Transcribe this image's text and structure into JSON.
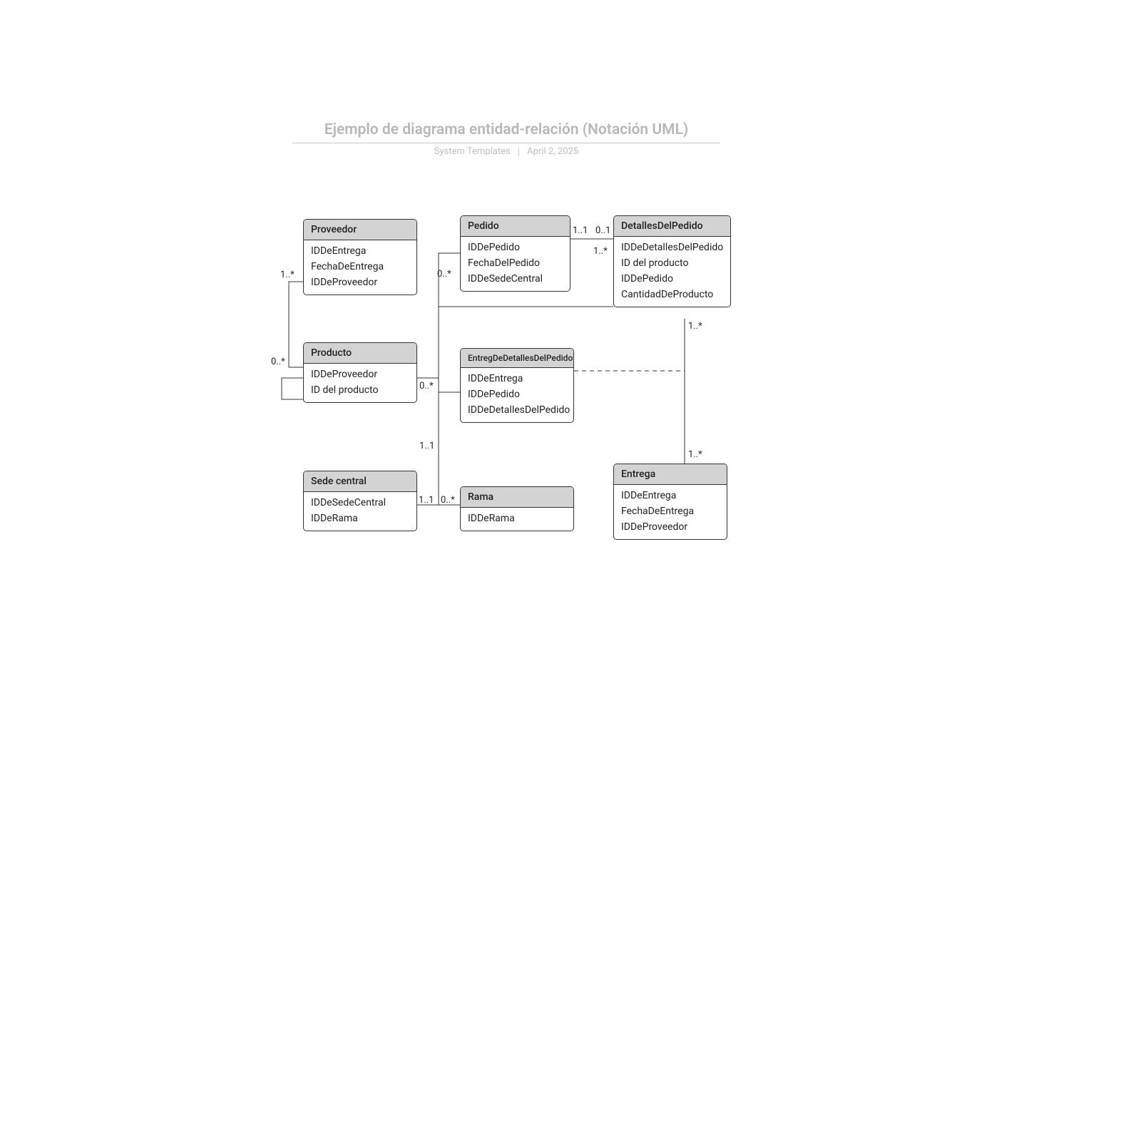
{
  "header": {
    "title": "Ejemplo de diagrama entidad-relación (Notación UML)",
    "sub_left": "System Templates",
    "sub_right": "April 2, 2025"
  },
  "entities": {
    "proveedor": {
      "name": "Proveedor",
      "attrs": [
        "IDDeEntrega",
        "FechaDeEntrega",
        "IDDeProveedor"
      ]
    },
    "producto": {
      "name": "Producto",
      "attrs": [
        "IDDeProveedor",
        "ID del producto"
      ]
    },
    "sede": {
      "name": "Sede central",
      "attrs": [
        "IDDeSedeCentral",
        "IDDeRama"
      ]
    },
    "pedido": {
      "name": "Pedido",
      "attrs": [
        "IDDePedido",
        "FechaDelPedido",
        "IDDeSedeCentral"
      ]
    },
    "entregdet": {
      "name": "EntregDeDetallesDelPedido",
      "attrs": [
        "IDDeEntrega",
        "IDDePedido",
        "IDDeDetallesDelPedido"
      ]
    },
    "rama": {
      "name": "Rama",
      "attrs": [
        "IDDeRama"
      ]
    },
    "detalles": {
      "name": "DetallesDelPedido",
      "attrs": [
        "IDDeDetallesDelPedido",
        "ID del producto",
        "IDDePedido",
        "CantidadDeProducto"
      ]
    },
    "entrega": {
      "name": "Entrega",
      "attrs": [
        "IDDeEntrega",
        "FechaDeEntrega",
        "IDDeProveedor"
      ]
    }
  },
  "mult": {
    "proveedor_side": "1..*",
    "producto_side_top": "0..*",
    "producto_right": "0..*",
    "pedido_left": "0..*",
    "pedido_right": "1..1",
    "detalles_left": "0..1",
    "detalles_below": "1..*",
    "sede_right": "1..1",
    "rama_left": "0..*",
    "sede_top_via": "1..1",
    "entrega_top": "1..*",
    "detalles_bottom_right": "1..*"
  }
}
